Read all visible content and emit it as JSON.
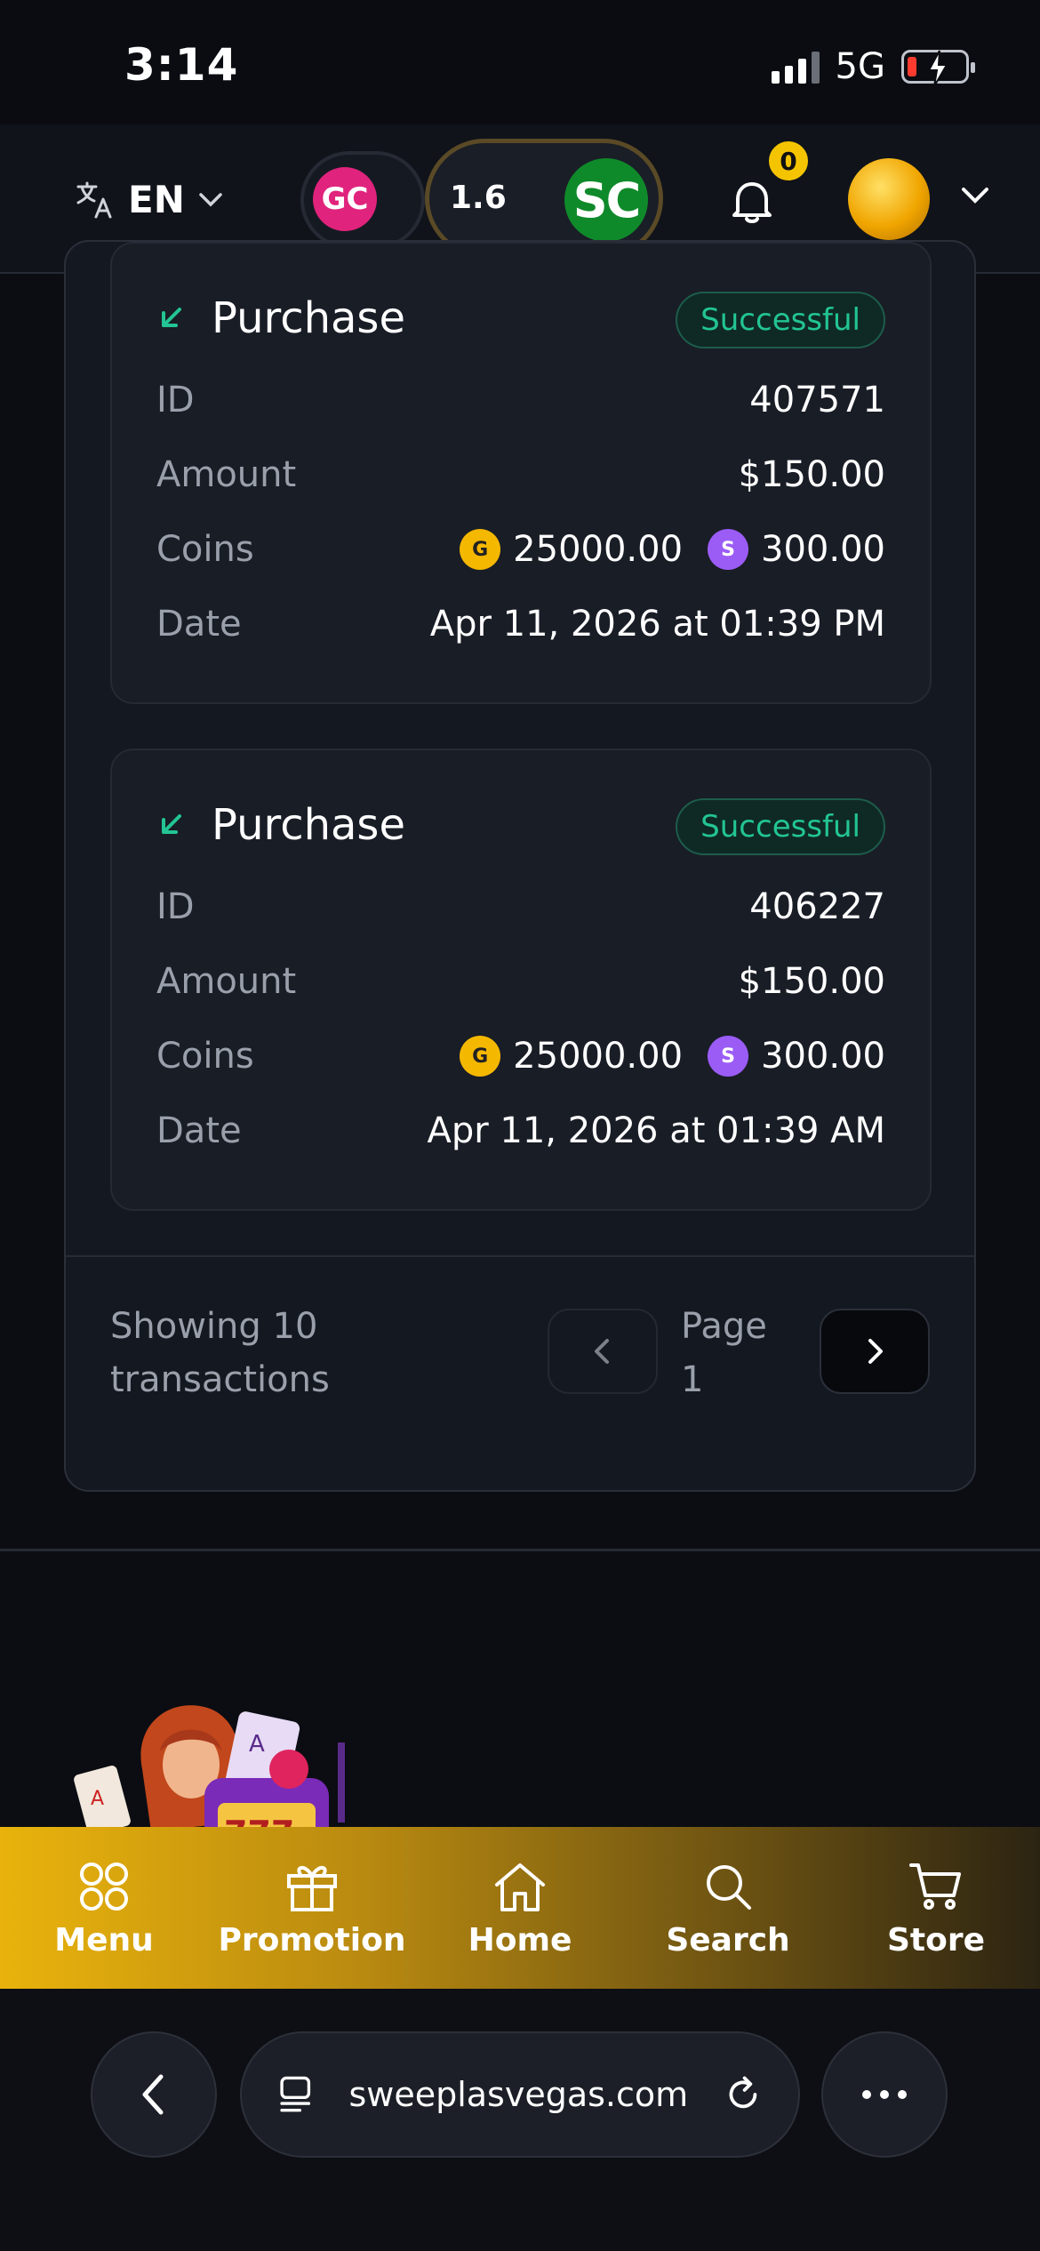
{
  "status_bar": {
    "time": "3:14",
    "network": "5G"
  },
  "header": {
    "language": "EN",
    "gc_label": "GC",
    "sc_amount": "1.6",
    "sc_label": "SC",
    "notification_count": "0"
  },
  "transactions": [
    {
      "type": "Purchase",
      "status": "Successful",
      "labels": {
        "id": "ID",
        "amount": "Amount",
        "coins": "Coins",
        "date": "Date"
      },
      "id": "407571",
      "amount": "$150.00",
      "gold_coins": "25000.00",
      "sweep_coins": "300.00",
      "date": "Apr 11, 2026 at 01:39 PM"
    },
    {
      "type": "Purchase",
      "status": "Successful",
      "labels": {
        "id": "ID",
        "amount": "Amount",
        "coins": "Coins",
        "date": "Date"
      },
      "id": "406227",
      "amount": "$150.00",
      "gold_coins": "25000.00",
      "sweep_coins": "300.00",
      "date": "Apr 11, 2026 at 01:39 AM"
    }
  ],
  "coin_symbols": {
    "gold": "G",
    "sweep": "S"
  },
  "pagination": {
    "showing": "Showing 10 transactions",
    "page_label": "Page 1"
  },
  "bottom_nav": {
    "menu": "Menu",
    "promotion": "Promotion",
    "home": "Home",
    "search": "Search",
    "store": "Store"
  },
  "browser": {
    "url": "sweeplasvegas.com"
  },
  "colors": {
    "success": "#22c593",
    "gold": "#f5b800",
    "sweep": "#9b5cf6",
    "accent": "#e9b30c"
  }
}
